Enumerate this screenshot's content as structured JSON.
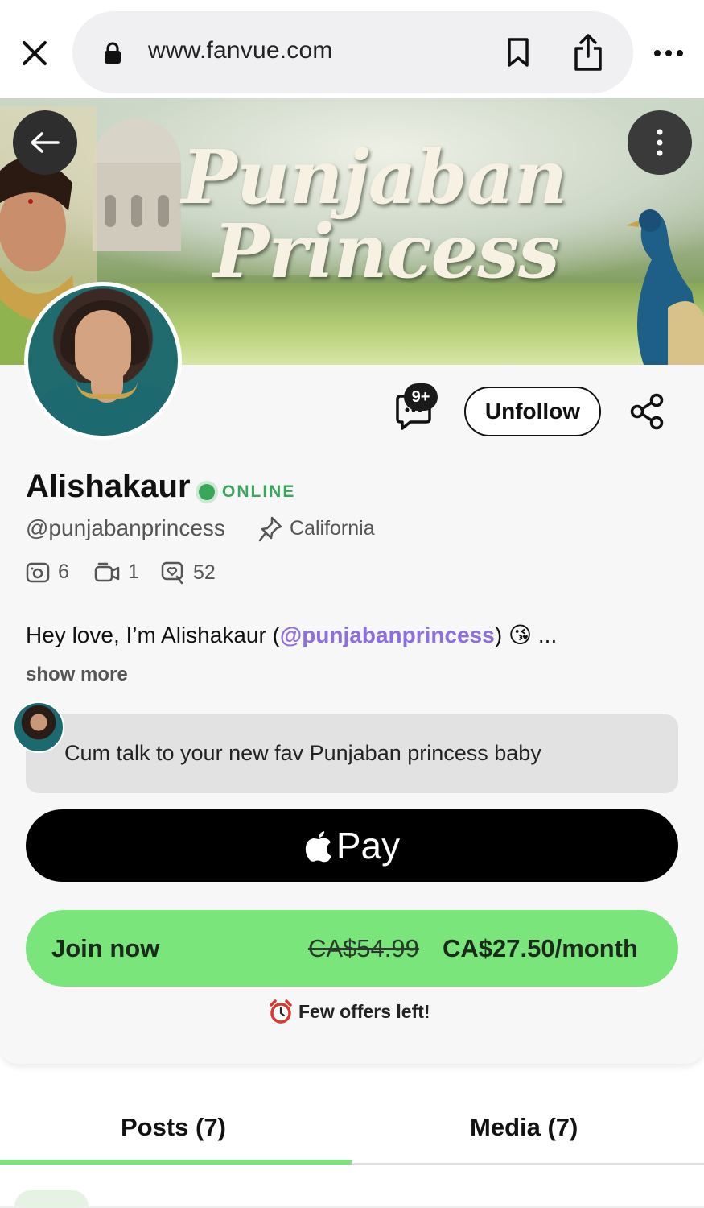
{
  "browser": {
    "url": "www.fanvue.com",
    "icons": [
      "close-icon",
      "lock-icon",
      "bookmark-icon",
      "share-icon",
      "more-icon"
    ]
  },
  "banner": {
    "title_line1": "Punjaban",
    "title_line2": "Princess"
  },
  "profile": {
    "name": "Alishakaur",
    "status": "ONLINE",
    "handle": "@punjabanprincess",
    "location": "California",
    "chat_badge": "9+",
    "unfollow_label": "Unfollow",
    "stats": {
      "photos": "6",
      "videos": "1",
      "posts": "52"
    },
    "bio_prefix": "Hey love, I’m Alishakaur (",
    "bio_mention": "@punjabanprincess",
    "bio_suffix": ") 😘 ...",
    "show_more": "show more",
    "promo_message": "Cum talk to your new fav Punjaban princess baby"
  },
  "payment": {
    "applepay_label": "Pay",
    "join_label": "Join now",
    "old_price": "CA$54.99",
    "new_price": "CA$27.50/month",
    "offer_text": "Few offers left!"
  },
  "tabs": [
    {
      "label": "Posts (7)",
      "active": true
    },
    {
      "label": "Media (7)",
      "active": false
    }
  ],
  "colors": {
    "accent_green": "#79e57a",
    "online_green": "#3aa55b",
    "mention_purple": "#8e6fe0"
  }
}
